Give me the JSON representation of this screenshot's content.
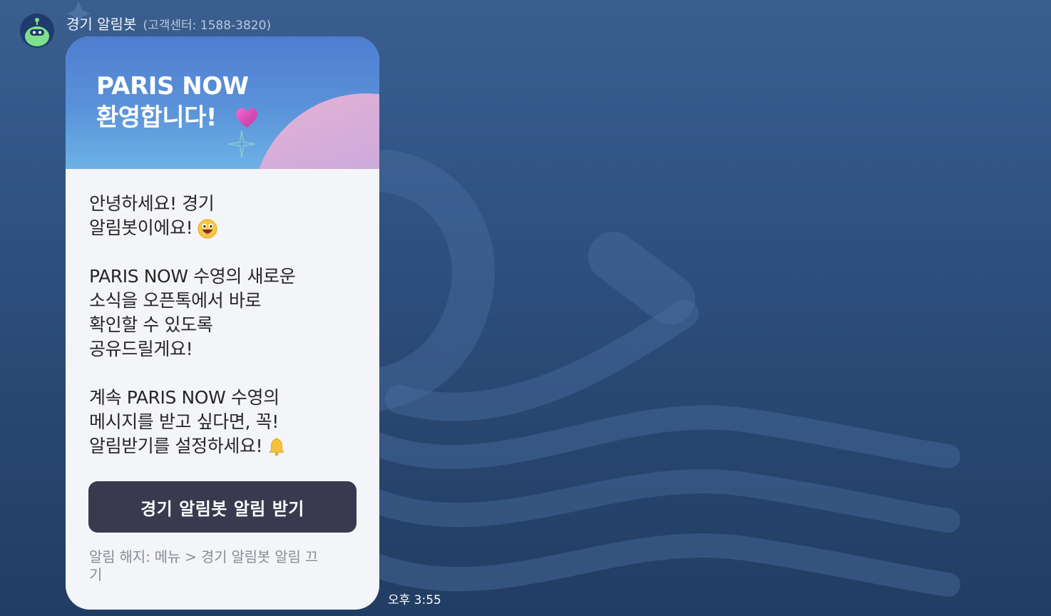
{
  "chat": {
    "sender_name": "경기 알림봇",
    "sender_sub": "(고객센터: 1588-3820)",
    "timestamp": "오후 3:55"
  },
  "banner": {
    "title_line1": "PARIS NOW",
    "title_line2": "환영합니다!",
    "icons": [
      "heart-icon",
      "sparkle-icon"
    ]
  },
  "message": {
    "paragraphs": [
      {
        "lines": [
          "안녕하세요! 경기",
          "알림봇이에요!"
        ],
        "trailing_icon": "grinning-face-emoji"
      },
      {
        "lines": [
          "PARIS NOW 수영의 새로운",
          "소식을 오픈톡에서 바로",
          "확인할 수 있도록",
          "공유드릴게요!"
        ]
      },
      {
        "lines": [
          "계속 PARIS NOW 수영의",
          "메시지를 받고 싶다면, 꼭!",
          "알림받기를 설정하세요!"
        ],
        "trailing_icon": "bell-emoji"
      }
    ]
  },
  "cta": {
    "label": "경기 알림봇 알림 받기"
  },
  "footer": {
    "unsubscribe_line1": "알림 해지: 메뉴 > 경기 알림봇 알림 끄",
    "unsubscribe_line2": "기"
  },
  "colors": {
    "background": "#2f5283",
    "bubble": "#f4f5f9",
    "cta": "#393a4e",
    "banner_top": "#4f7dd0",
    "banner_bottom": "#6db1e6"
  }
}
